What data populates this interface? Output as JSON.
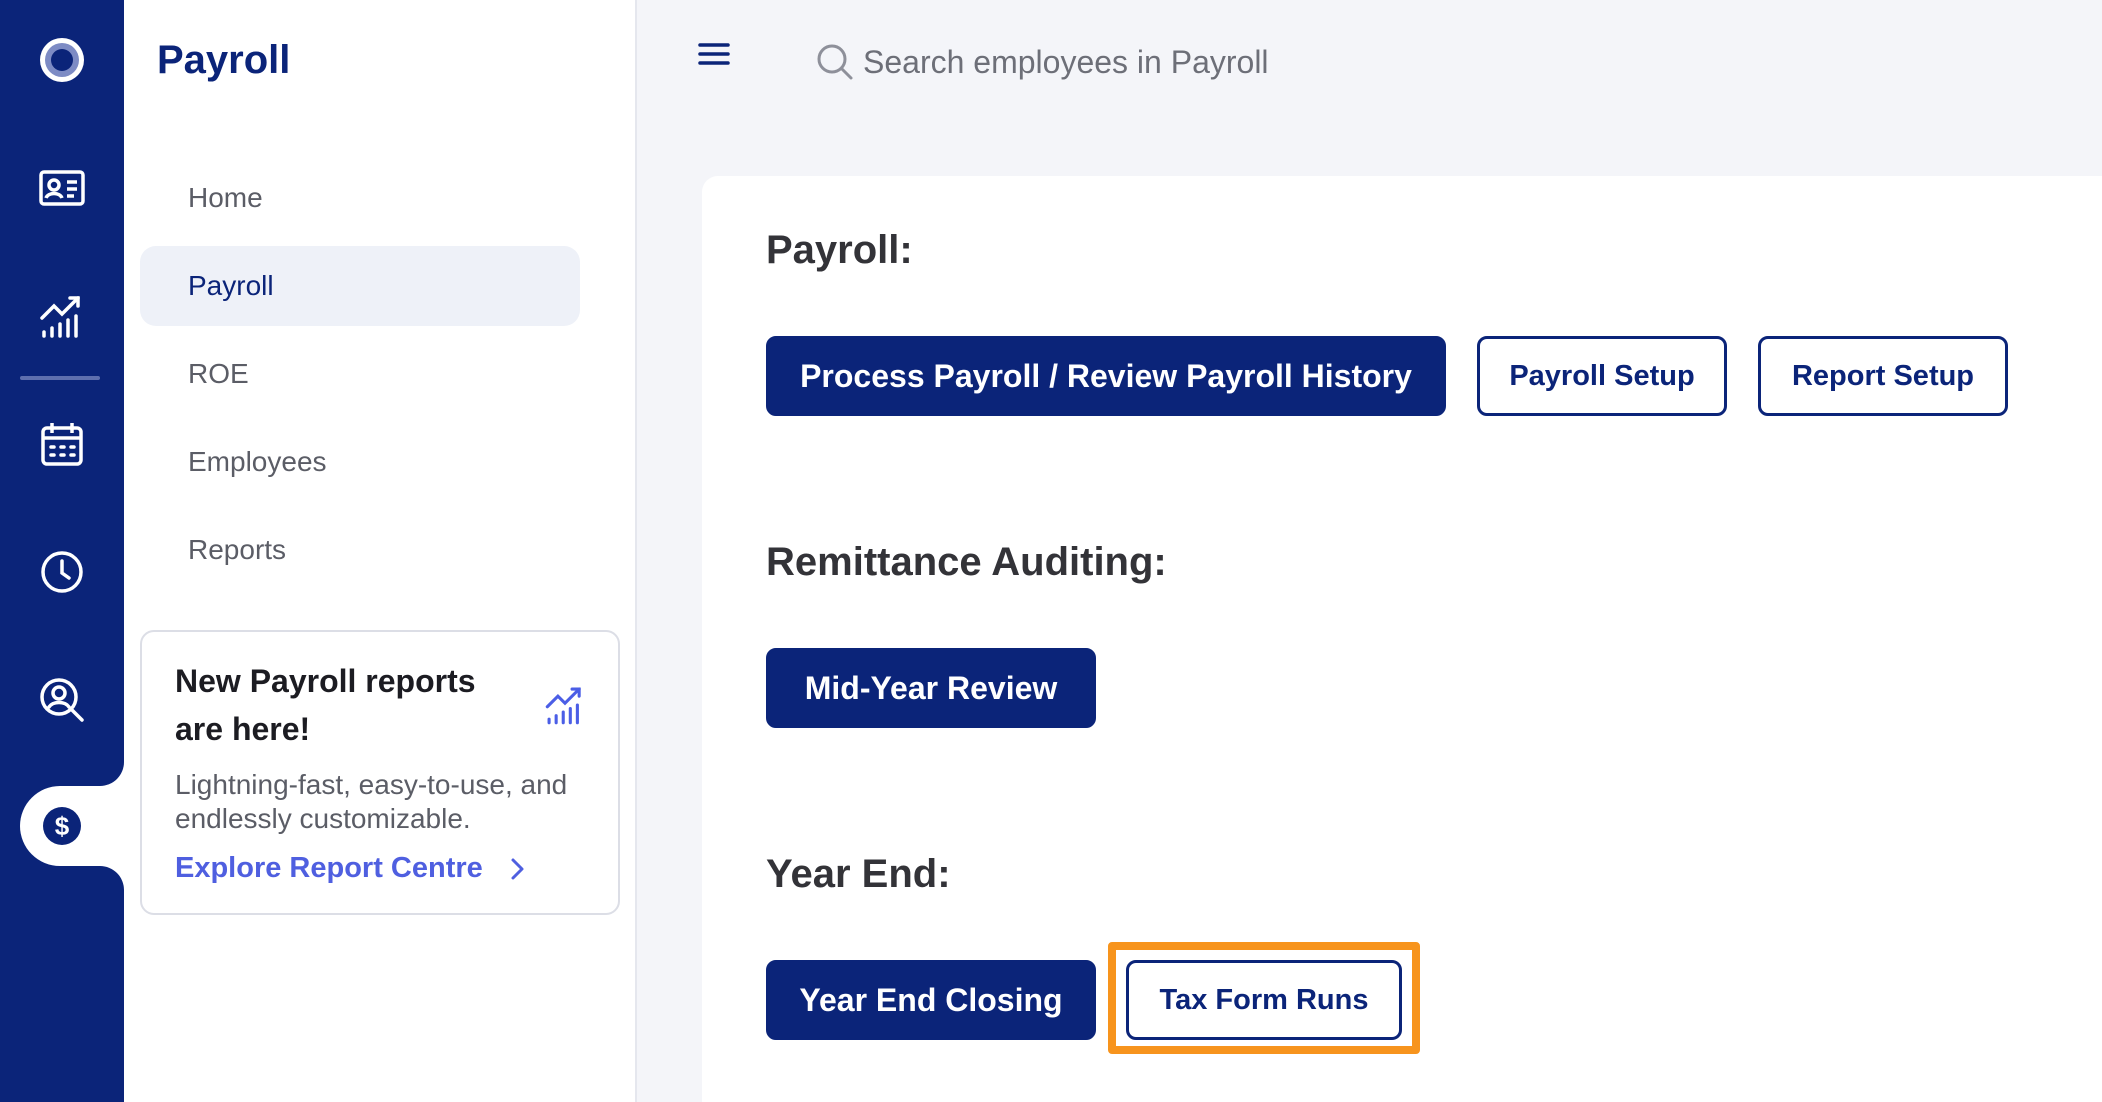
{
  "app": {
    "title": "Payroll"
  },
  "rail": {
    "items": [
      {
        "icon": "logo-icon",
        "label": ""
      },
      {
        "icon": "id-card-icon",
        "label": ""
      },
      {
        "icon": "analytics-icon",
        "label": ""
      },
      {
        "icon": "calendar-icon",
        "label": ""
      },
      {
        "icon": "clock-icon",
        "label": ""
      },
      {
        "icon": "person-search-icon",
        "label": ""
      },
      {
        "icon": "dollar-icon",
        "label": "",
        "active": true
      }
    ]
  },
  "sidebar": {
    "title": "Payroll",
    "items": [
      {
        "label": "Home",
        "active": false
      },
      {
        "label": "Payroll",
        "active": true
      },
      {
        "label": "ROE",
        "active": false
      },
      {
        "label": "Employees",
        "active": false
      },
      {
        "label": "Reports",
        "active": false
      }
    ],
    "promo": {
      "title": "New Payroll reports are here!",
      "text": "Lightning-fast, easy-to-use, and endlessly customizable.",
      "link": "Explore Report Centre",
      "icon": "analytics-icon"
    }
  },
  "search": {
    "placeholder": "Search employees in Payroll"
  },
  "main": {
    "sections": [
      {
        "title": "Payroll:",
        "buttons": [
          "Process Payroll / Review Payroll History",
          "Payroll Setup",
          "Report Setup"
        ]
      },
      {
        "title": "Remittance Auditing:",
        "buttons": [
          "Mid-Year Review"
        ]
      },
      {
        "title": "Year End:",
        "buttons": [
          "Year End Closing",
          "Tax Form Runs"
        ]
      }
    ]
  },
  "colors": {
    "brand_navy": "#0b2479",
    "accent_blue": "#4f5fe0",
    "highlight_orange": "#f7941d",
    "background": "#f4f5f9"
  }
}
